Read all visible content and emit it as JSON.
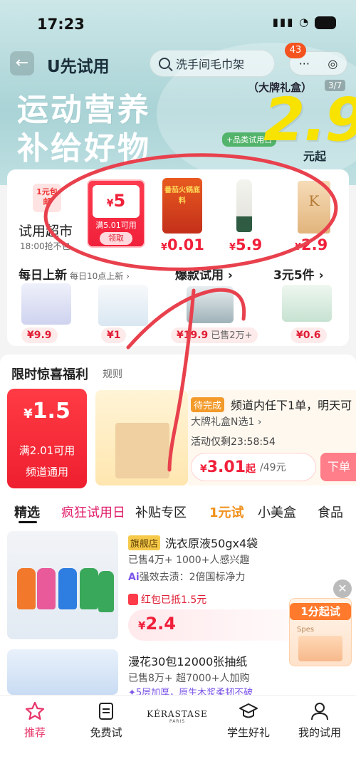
{
  "status_bar": {
    "time": "17:23",
    "battery": ""
  },
  "header": {
    "title": "U先试用",
    "search_placeholder": "洗手间毛巾架",
    "badge_count": "43",
    "capsule_more": "···",
    "capsule_close": "◎"
  },
  "banner": {
    "tag": "（大牌礼盒）",
    "page": "3/7",
    "line1": "运动营养",
    "line2": "补给好物",
    "small_badge": "+品类试用日",
    "price": "2.9",
    "unit": "元起"
  },
  "supermarket": {
    "tag": "1元包邮",
    "title": "试用超市",
    "subtitle": "18:00抢不包",
    "coupon": {
      "currency": "¥",
      "amount": "5",
      "condition": "满5.01可用",
      "button": "领取"
    },
    "products": [
      {
        "name": "番茄火锅底料",
        "price_prefix": "¥",
        "price": "0.01"
      },
      {
        "name": "",
        "price_prefix": "¥",
        "price": "5.9"
      },
      {
        "name": "K",
        "price_prefix": "¥",
        "price": "2.9"
      }
    ]
  },
  "sections": {
    "new": {
      "title": "每日上新",
      "subtitle": "每日10点上新 ›"
    },
    "hot": {
      "title": "爆款试用 ›"
    },
    "three": {
      "title": "3元5件 ›"
    },
    "prices": [
      {
        "price": "¥9.9"
      },
      {
        "price": "¥1"
      },
      {
        "price": "¥19.9",
        "sold": "已售2万+"
      },
      {
        "price": "¥0.6"
      }
    ]
  },
  "limited": {
    "title": "限时惊喜福利",
    "rule": "规则",
    "coupon": {
      "currency": "¥",
      "amount": "1.5",
      "condition": "满2.01可用",
      "scope": "频道通用"
    },
    "status": "待完成",
    "desc": "频道内任下1单，明天可",
    "name": "大牌礼盒N选1 ›",
    "timer": "活动仅剩23:58:54",
    "price_cur": "¥",
    "price": "3.01",
    "price_suffix": "起",
    "original": "/49元",
    "order_btn": "下单"
  },
  "tabs": [
    "精选",
    "疯狂试用日",
    "补贴专区",
    "1元试",
    "小美盒",
    "食品"
  ],
  "items": [
    {
      "tag": "旗舰店",
      "title": "洗衣原液50gx4袋",
      "sold": "已售4万+  1000+人感兴趣",
      "ai_label": "Ai",
      "ai_text": "强效去渍：2倍国标净力",
      "coupon": "红包已抵1.5元",
      "price_cur": "¥",
      "price": "2.4"
    },
    {
      "title": "漫花30包12000张抽纸",
      "sold": "已售8万+  超7000+人加购",
      "extra": "✦5层加厚，原生木浆柔韧不破"
    }
  ],
  "float_ad": {
    "title": "1分起试",
    "brand": "Spes"
  },
  "bottom_nav": [
    {
      "label": "推荐",
      "icon": "star-icon"
    },
    {
      "label": "免费试",
      "icon": "ticket-icon"
    },
    {
      "label": "KÉRASTASE",
      "sub": "PARIS",
      "icon": "brand-logo"
    },
    {
      "label": "学生好礼",
      "icon": "graduation-cap-icon"
    },
    {
      "label": "我的试用",
      "icon": "user-icon"
    }
  ],
  "colors": {
    "accent": "#f0203a",
    "header_bg": "#a9d3d6",
    "banner_price": "#f7e200",
    "annotation": "#e8414d"
  }
}
